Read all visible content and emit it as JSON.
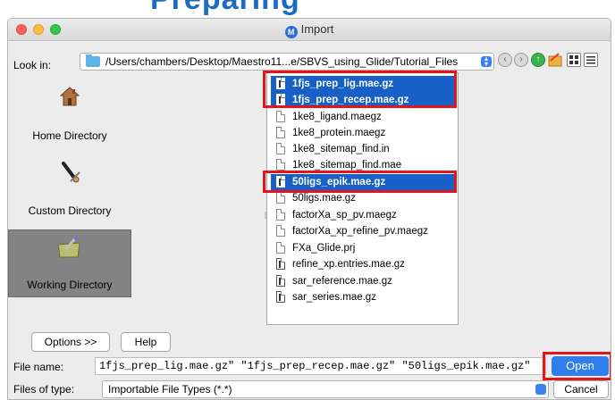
{
  "background_heading": "Preparing",
  "window": {
    "title": "Import",
    "app_icon_letter": "M"
  },
  "look_in": {
    "label": "Look in:",
    "path": "/Users/chambers/Desktop/Maestro11...e/SBVS_using_Glide/Tutorial_Files"
  },
  "sidebar": {
    "items": [
      {
        "label": "Home Directory",
        "icon": "home-icon"
      },
      {
        "label": "Custom Directory",
        "icon": "custom-directory-icon"
      },
      {
        "label": "Working Directory",
        "icon": "working-directory-icon",
        "selected": true
      }
    ]
  },
  "files": [
    {
      "name": "1fjs_prep_lig.mae.gz",
      "selected": true,
      "icon": "executable-file-icon"
    },
    {
      "name": "1fjs_prep_recep.mae.gz",
      "selected": true,
      "icon": "executable-file-icon"
    },
    {
      "name": "1ke8_ligand.maegz",
      "selected": false,
      "icon": "file-icon"
    },
    {
      "name": "1ke8_protein.maegz",
      "selected": false,
      "icon": "file-icon"
    },
    {
      "name": "1ke8_sitemap_find.in",
      "selected": false,
      "icon": "file-icon"
    },
    {
      "name": "1ke8_sitemap_find.mae",
      "selected": false,
      "icon": "file-icon"
    },
    {
      "name": "50ligs_epik.mae.gz",
      "selected": true,
      "icon": "executable-file-icon"
    },
    {
      "name": "50ligs.mae.gz",
      "selected": false,
      "icon": "file-icon"
    },
    {
      "name": "factorXa_sp_pv.maegz",
      "selected": false,
      "icon": "file-icon"
    },
    {
      "name": "factorXa_xp_refine_pv.maegz",
      "selected": false,
      "icon": "file-icon"
    },
    {
      "name": "FXa_Glide.prj",
      "selected": false,
      "icon": "file-icon"
    },
    {
      "name": "refine_xp.entries.mae.gz",
      "selected": false,
      "icon": "executable-file-icon"
    },
    {
      "name": "sar_reference.mae.gz",
      "selected": false,
      "icon": "executable-file-icon"
    },
    {
      "name": "sar_series.mae.gz",
      "selected": false,
      "icon": "executable-file-icon"
    }
  ],
  "buttons": {
    "options": "Options >>",
    "help": "Help",
    "open": "Open",
    "cancel": "Cancel"
  },
  "file_name": {
    "label": "File name:",
    "value": "1fjs_prep_lig.mae.gz\" \"1fjs_prep_recep.mae.gz\" \"50ligs_epik.mae.gz\""
  },
  "file_type": {
    "label": "Files of type:",
    "value": "Importable File Types (*.*)"
  },
  "colors": {
    "selection": "#1660c8",
    "highlight_box": "#e5141a",
    "open_button": "#2f7ef0"
  }
}
